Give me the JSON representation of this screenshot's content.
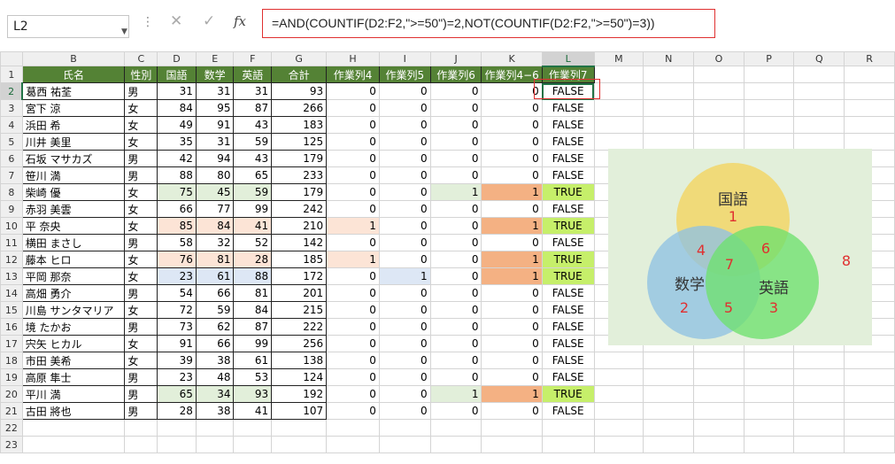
{
  "formula_bar": {
    "name_box": "L2",
    "cancel_icon": "✕",
    "enter_icon": "✓",
    "fx_label": "fx",
    "formula": "=AND(COUNTIF(D2:F2,\">=50\")=2,NOT(COUNTIF(D2:F2,\">=50\")=3))"
  },
  "columns": [
    "B",
    "C",
    "D",
    "E",
    "F",
    "G",
    "H",
    "I",
    "J",
    "K",
    "L",
    "M",
    "N",
    "O",
    "P",
    "Q",
    "R"
  ],
  "selected_column": "L",
  "selected_row": 2,
  "header_row": [
    "氏名",
    "性別",
    "国語",
    "数学",
    "英語",
    "合計",
    "作業列4",
    "作業列5",
    "作業列6",
    "作業列4−6",
    "作業列7"
  ],
  "rows": [
    {
      "name": "葛西 祐荃",
      "sex": "男",
      "kokugo": 31,
      "sugaku": 31,
      "eigo": 31,
      "total": 93,
      "w4": 0,
      "w5": 0,
      "w6": 0,
      "w46": 0,
      "w7": "FALSE"
    },
    {
      "name": "宮下 涼",
      "sex": "女",
      "kokugo": 84,
      "sugaku": 95,
      "eigo": 87,
      "total": 266,
      "w4": 0,
      "w5": 0,
      "w6": 0,
      "w46": 0,
      "w7": "FALSE"
    },
    {
      "name": "浜田 希",
      "sex": "女",
      "kokugo": 49,
      "sugaku": 91,
      "eigo": 43,
      "total": 183,
      "w4": 0,
      "w5": 0,
      "w6": 0,
      "w46": 0,
      "w7": "FALSE"
    },
    {
      "name": "川井 美里",
      "sex": "女",
      "kokugo": 35,
      "sugaku": 31,
      "eigo": 59,
      "total": 125,
      "w4": 0,
      "w5": 0,
      "w6": 0,
      "w46": 0,
      "w7": "FALSE"
    },
    {
      "name": "石坂 マサカズ",
      "sex": "男",
      "kokugo": 42,
      "sugaku": 94,
      "eigo": 43,
      "total": 179,
      "w4": 0,
      "w5": 0,
      "w6": 0,
      "w46": 0,
      "w7": "FALSE"
    },
    {
      "name": "笹川 満",
      "sex": "男",
      "kokugo": 88,
      "sugaku": 80,
      "eigo": 65,
      "total": 233,
      "w4": 0,
      "w5": 0,
      "w6": 0,
      "w46": 0,
      "w7": "FALSE"
    },
    {
      "name": "柴崎 優",
      "sex": "女",
      "kokugo": 75,
      "sugaku": 45,
      "eigo": 59,
      "total": 179,
      "w4": 0,
      "w5": 0,
      "w6": 1,
      "w46": 1,
      "w7": "TRUE"
    },
    {
      "name": "赤羽 美雲",
      "sex": "女",
      "kokugo": 66,
      "sugaku": 77,
      "eigo": 99,
      "total": 242,
      "w4": 0,
      "w5": 0,
      "w6": 0,
      "w46": 0,
      "w7": "FALSE"
    },
    {
      "name": "平 奈央",
      "sex": "女",
      "kokugo": 85,
      "sugaku": 84,
      "eigo": 41,
      "total": 210,
      "w4": 1,
      "w5": 0,
      "w6": 0,
      "w46": 1,
      "w7": "TRUE"
    },
    {
      "name": "横田 まさし",
      "sex": "男",
      "kokugo": 58,
      "sugaku": 32,
      "eigo": 52,
      "total": 142,
      "w4": 0,
      "w5": 0,
      "w6": 0,
      "w46": 0,
      "w7": "FALSE"
    },
    {
      "name": "藤本 ヒロ",
      "sex": "女",
      "kokugo": 76,
      "sugaku": 81,
      "eigo": 28,
      "total": 185,
      "w4": 1,
      "w5": 0,
      "w6": 0,
      "w46": 1,
      "w7": "TRUE"
    },
    {
      "name": "平岡 那奈",
      "sex": "女",
      "kokugo": 23,
      "sugaku": 61,
      "eigo": 88,
      "total": 172,
      "w4": 0,
      "w5": 1,
      "w6": 0,
      "w46": 1,
      "w7": "TRUE"
    },
    {
      "name": "高畑 勇介",
      "sex": "男",
      "kokugo": 54,
      "sugaku": 66,
      "eigo": 81,
      "total": 201,
      "w4": 0,
      "w5": 0,
      "w6": 0,
      "w46": 0,
      "w7": "FALSE"
    },
    {
      "name": "川島 サンタマリア",
      "sex": "女",
      "kokugo": 72,
      "sugaku": 59,
      "eigo": 84,
      "total": 215,
      "w4": 0,
      "w5": 0,
      "w6": 0,
      "w46": 0,
      "w7": "FALSE"
    },
    {
      "name": "境 たかお",
      "sex": "男",
      "kokugo": 73,
      "sugaku": 62,
      "eigo": 87,
      "total": 222,
      "w4": 0,
      "w5": 0,
      "w6": 0,
      "w46": 0,
      "w7": "FALSE"
    },
    {
      "name": "宍矢 ヒカル",
      "sex": "女",
      "kokugo": 91,
      "sugaku": 66,
      "eigo": 99,
      "total": 256,
      "w4": 0,
      "w5": 0,
      "w6": 0,
      "w46": 0,
      "w7": "FALSE"
    },
    {
      "name": "市田 美希",
      "sex": "女",
      "kokugo": 39,
      "sugaku": 38,
      "eigo": 61,
      "total": 138,
      "w4": 0,
      "w5": 0,
      "w6": 0,
      "w46": 0,
      "w7": "FALSE"
    },
    {
      "name": "高原 隼士",
      "sex": "男",
      "kokugo": 23,
      "sugaku": 48,
      "eigo": 53,
      "total": 124,
      "w4": 0,
      "w5": 0,
      "w6": 0,
      "w46": 0,
      "w7": "FALSE"
    },
    {
      "name": "平川 満",
      "sex": "男",
      "kokugo": 65,
      "sugaku": 34,
      "eigo": 93,
      "total": 192,
      "w4": 0,
      "w5": 0,
      "w6": 1,
      "w46": 1,
      "w7": "TRUE"
    },
    {
      "name": "古田 將也",
      "sex": "男",
      "kokugo": 28,
      "sugaku": 38,
      "eigo": 41,
      "total": 107,
      "w4": 0,
      "w5": 0,
      "w6": 0,
      "w46": 0,
      "w7": "FALSE"
    }
  ],
  "fills": {
    "green_light": "#e2efda",
    "peach": "#fce4d6",
    "blue_light": "#dde7f5",
    "orange": "#f4b183",
    "lime": "#c6ef6a",
    "header_green": "#548235"
  },
  "venn": {
    "bg": "#e2efda",
    "circles": [
      {
        "label": "国語",
        "color": "#f4d35e"
      },
      {
        "label": "数学",
        "color": "#8fc1e3"
      },
      {
        "label": "英語",
        "color": "#6ee06e"
      }
    ],
    "regions": {
      "only_kokugo": "1",
      "only_sugaku": "2",
      "only_eigo": "3",
      "kokugo_sugaku": "4",
      "sugaku_eigo": "5",
      "kokugo_eigo": "6",
      "all": "7",
      "outside": "8"
    },
    "number_color": "#e03030"
  }
}
